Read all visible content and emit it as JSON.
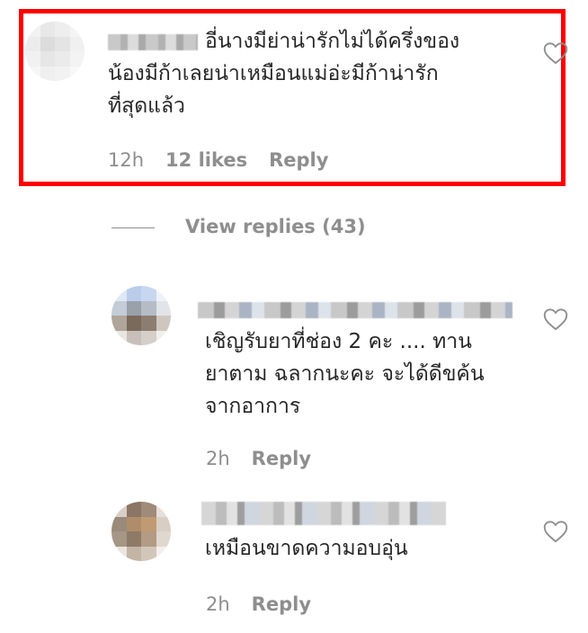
{
  "comments": [
    {
      "text_lines": [
        "อี่นางมีย่าน่ารักไม่ได้ครึ่งของ",
        "น้องมีก้าเลยน่าเหมือนแม่อ่ะมีก้าน่ารัก",
        "ที่สุดแล้ว"
      ],
      "time": "12h",
      "likes": "12 likes",
      "reply": "Reply"
    },
    {
      "text_lines": [
        "เชิญรับยาที่ช่อง 2 คะ .... ทาน",
        "ยาตาม ฉลากนะคะ จะได้ดีขค้น",
        "จากอาการ"
      ],
      "time": "2h",
      "reply": "Reply"
    },
    {
      "text_lines": [
        "เหมือนขาดความอบอุ่น"
      ],
      "time": "2h",
      "reply": "Reply"
    }
  ],
  "view_replies": "View replies (43)",
  "icons": {
    "like": "heart-icon"
  },
  "colors": {
    "highlight": "#ff0000",
    "meta": "#8e8e8e",
    "text": "#262626"
  }
}
